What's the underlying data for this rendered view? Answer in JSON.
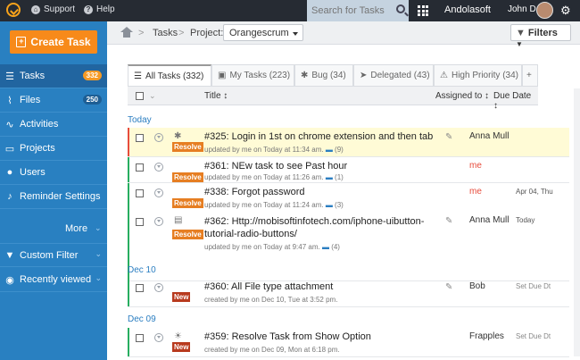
{
  "topbar": {
    "support": "Support",
    "help": "Help",
    "search_placeholder": "Search for Tasks",
    "company": "Andolasoft",
    "user": "John D"
  },
  "sidebar": {
    "create": "Create Task",
    "items": [
      {
        "label": "Tasks",
        "badge": "332",
        "badge_color": "#f59a25",
        "active": true
      },
      {
        "label": "Files",
        "badge": "250",
        "badge_color": "#1d5e94"
      },
      {
        "label": "Activities"
      },
      {
        "label": "Projects"
      },
      {
        "label": "Users"
      },
      {
        "label": "Reminder Settings"
      }
    ],
    "more": "More",
    "custom_filter": "Custom Filter",
    "recently_viewed": "Recently viewed"
  },
  "header": {
    "tasks": "Tasks",
    "sep": ">",
    "project_label": "Project:",
    "project": "Orangescrum",
    "filters": "Filters"
  },
  "tabs": [
    "All Tasks (332)",
    "My Tasks (223)",
    "Bug (34)",
    "Delegated (43)",
    "High Priority (34)",
    "+"
  ],
  "table_headers": {
    "title": "Title ↕",
    "assigned": "Assigned to ↕",
    "due": "Due Date ↕"
  },
  "groups": [
    {
      "label": "Today",
      "rows": [
        {
          "title": "#325: Login in 1st on chrome extension and then tab",
          "meta": "updated by me on Today at 11:34 am.",
          "comments": "(9)",
          "status": "Resolve",
          "assigned": "Anna Mull",
          "due": "",
          "stripe": "#e74c3c",
          "highlight": true,
          "clip": true
        },
        {
          "title": "#361: NEw task to see Past hour",
          "meta": "updated by me on Today at 11:26 am.",
          "comments": "(1)",
          "status": "Resolve",
          "assigned": "me",
          "due": "",
          "stripe": "#27ae60",
          "clip": false
        },
        {
          "title": "#338: Forgot password",
          "meta": "updated by me on Today at 11:24 am.",
          "comments": "(3)",
          "status": "Resolve",
          "assigned": "me",
          "due": "Apr 04, Thu",
          "stripe": "#27ae60",
          "clip": false
        },
        {
          "title": "#362: Http://mobisoftinfotech.com/iphone-uibutton-tutorial-radio-buttons/",
          "meta": "updated by me on Today at 9:47 am.",
          "comments": "(4)",
          "status": "Resolve",
          "assigned": "Anna Mull",
          "due": "Today",
          "stripe": "#27ae60",
          "clip": true
        }
      ]
    },
    {
      "label": "Dec 10",
      "rows": [
        {
          "title": "#360: All File type attachment",
          "meta": "created by me on Dec 10, Tue at 3:52 pm.",
          "comments": "",
          "status": "New",
          "assigned": "Bob",
          "due": "Set Due Dt",
          "stripe": "#27ae60",
          "clip": true
        }
      ]
    },
    {
      "label": "Dec 09",
      "rows": [
        {
          "title": "#359: Resolve Task from Show Option",
          "meta": "created by me on Dec 09, Mon at 6:18 pm.",
          "comments": "",
          "status": "New",
          "assigned": "Frapples",
          "due": "Set Due Dt",
          "stripe": "#27ae60",
          "clip": false
        }
      ]
    }
  ]
}
